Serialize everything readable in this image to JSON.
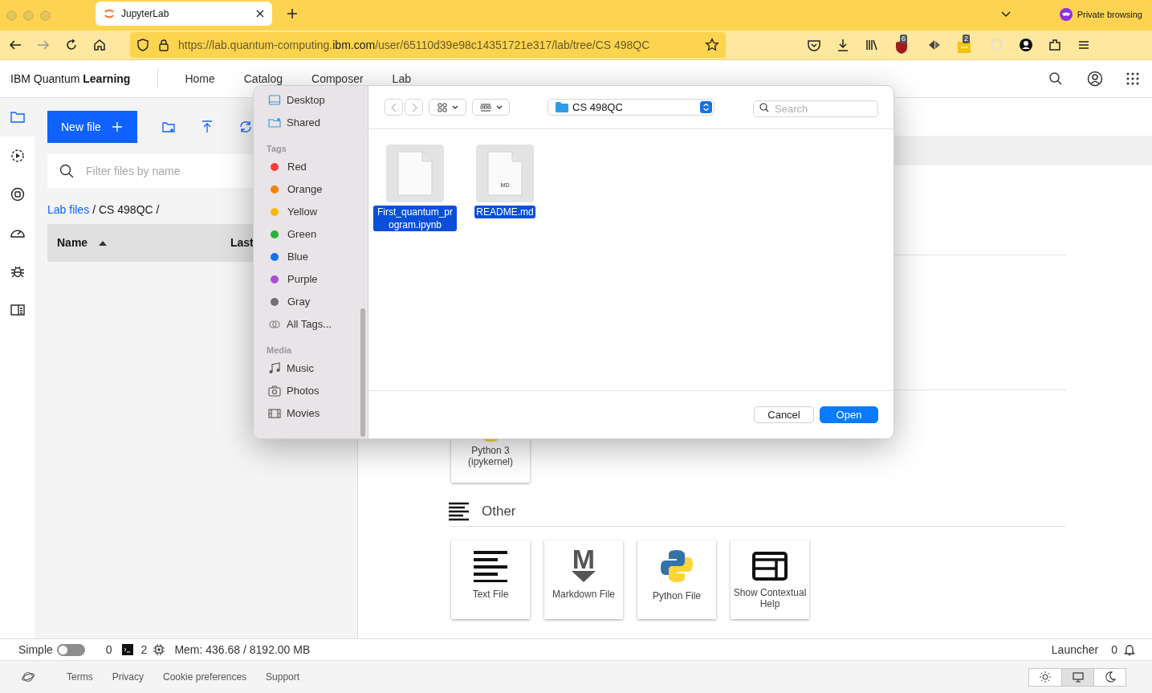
{
  "browser": {
    "tab_title": "JupyterLab",
    "url_start": "https://lab.quantum-computing.",
    "url_domain": "ibm.com",
    "url_end": "/user/65110d39e98c14351721e317/lab/tree/CS 498QC",
    "private_label": "Private browsing",
    "extension_badges": [
      "6",
      "2"
    ]
  },
  "app_header": {
    "brand": "IBM Quantum **Learning**",
    "nav": [
      "Home",
      "Catalog",
      "Composer",
      "Lab"
    ]
  },
  "activity_bar": [
    {
      "selected": true
    },
    {
      "selected": false
    },
    {
      "selected": false
    },
    {
      "selected": false
    },
    {
      "selected": false
    },
    {
      "selected": false
    }
  ],
  "file_panel": {
    "new_file": "New file",
    "filter_placeholder": "Filter files by name",
    "breadcrumb_link": "Lab files",
    "breadcrumb_rest": "/ CS 498QC /",
    "columns": [
      "Name",
      "Last"
    ]
  },
  "dialog": {
    "sidebar": [
      {
        "kind": "desktop",
        "label": "Desktop"
      },
      {
        "kind": "shared",
        "label": "Shared"
      },
      {
        "kind": "heading",
        "label": "Tags"
      },
      {
        "kind": "tag",
        "label": "Red",
        "color": "#fa3f3b"
      },
      {
        "kind": "tag",
        "label": "Orange",
        "color": "#f5820d"
      },
      {
        "kind": "tag",
        "label": "Yellow",
        "color": "#f4b90b"
      },
      {
        "kind": "tag",
        "label": "Green",
        "color": "#26b53a"
      },
      {
        "kind": "tag",
        "label": "Blue",
        "color": "#1372f5"
      },
      {
        "kind": "tag",
        "label": "Purple",
        "color": "#a94ed5"
      },
      {
        "kind": "tag",
        "label": "Gray",
        "color": "#707074"
      },
      {
        "kind": "all-tags",
        "label": "All Tags..."
      },
      {
        "kind": "heading",
        "label": "Media"
      },
      {
        "kind": "music",
        "label": "Music"
      },
      {
        "kind": "photos",
        "label": "Photos"
      },
      {
        "kind": "movies",
        "label": "Movies"
      }
    ],
    "folder": "CS 498QC",
    "search_placeholder": "Search",
    "files": [
      {
        "name": "First_quantum_program.ipynb",
        "selected": true
      },
      {
        "name": "README.md",
        "badge": "MD",
        "selected": true
      }
    ],
    "buttons": [
      {
        "label": "Cancel",
        "kind": "secondary"
      },
      {
        "label": "Open",
        "kind": "primary"
      }
    ]
  },
  "launcher": {
    "kernel_card": "Python 3 (ipykernel)",
    "section": "Other",
    "cards": [
      {
        "kind": "text",
        "label": "Text File"
      },
      {
        "kind": "markdown",
        "label": "Markdown File",
        "glyph": "M"
      },
      {
        "kind": "python",
        "label": "Python File"
      },
      {
        "kind": "help",
        "label": "Show Contextual Help"
      }
    ]
  },
  "status_bar": {
    "mode_label": "Simple",
    "simple_on": false,
    "terminals": "0",
    "kernels": "2",
    "memory": "Mem: 436.68 / 8192.00 MB",
    "right_label": "Launcher",
    "notifications": "0"
  },
  "footer": {
    "links": [
      "Terms",
      "Privacy",
      "Cookie preferences",
      "Support"
    ],
    "theme": [
      {
        "selected": false
      },
      {
        "selected": true
      },
      {
        "selected": false
      }
    ]
  }
}
